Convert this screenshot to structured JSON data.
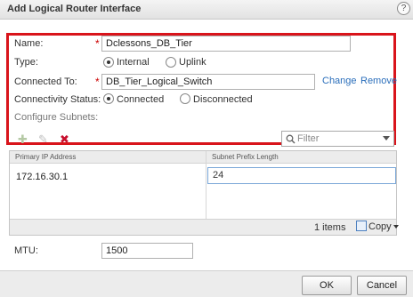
{
  "dialog": {
    "title": "Add Logical Router Interface",
    "help_glyph": "?"
  },
  "form": {
    "name_label": "Name:",
    "name_value": "Dclessons_DB_Tier",
    "required_mark": "*",
    "type_label": "Type:",
    "type_options": [
      "Internal",
      "Uplink"
    ],
    "type_selected": "Internal",
    "connected_to_label": "Connected To:",
    "connected_to_value": "DB_Tier_Logical_Switch",
    "change_link": "Change",
    "remove_link": "Remove",
    "connectivity_label": "Connectivity Status:",
    "connectivity_options": [
      "Connected",
      "Disconnected"
    ],
    "connectivity_selected": "Connected",
    "configure_subnets_label": "Configure Subnets:"
  },
  "toolbar": {
    "icons": [
      "add-icon",
      "edit-icon",
      "delete-icon"
    ],
    "delete_color": "#c8102e",
    "filter_placeholder": "Filter"
  },
  "grid": {
    "columns": [
      "Primary IP Address",
      "Subnet Prefix Length"
    ],
    "rows": [
      {
        "primary_ip": "172.16.30.1",
        "prefix_length": "24"
      }
    ],
    "items_count": "1 items",
    "copy_label": "Copy"
  },
  "mtu": {
    "label": "MTU:",
    "value": "1500"
  },
  "buttons": {
    "ok": "OK",
    "cancel": "Cancel"
  },
  "colors": {
    "highlight": "#d9141b",
    "link": "#2a6ebb"
  }
}
